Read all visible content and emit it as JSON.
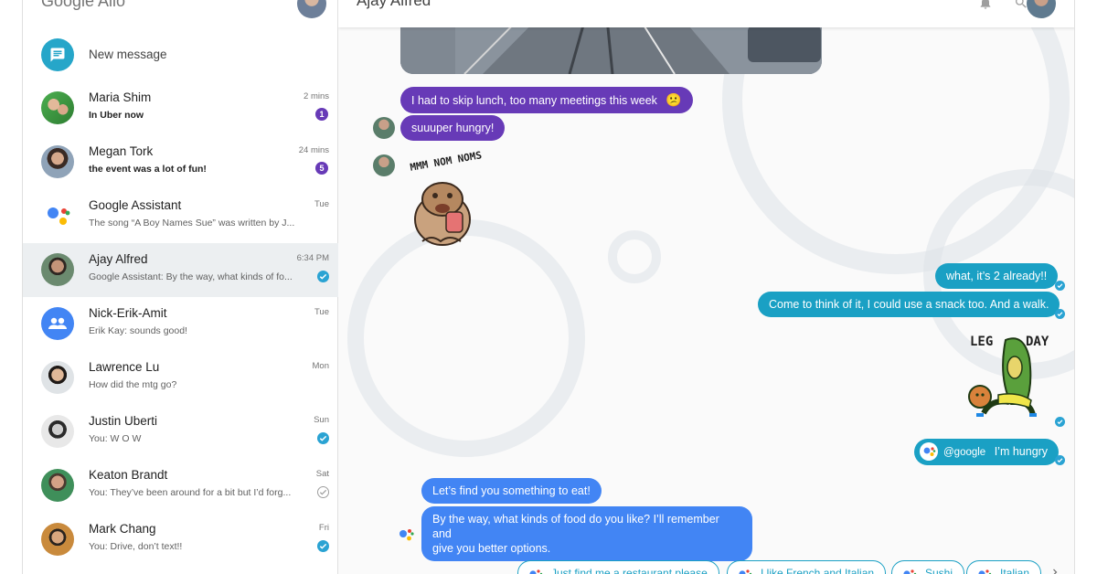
{
  "app": {
    "brand": "Google Allo"
  },
  "sidebar": {
    "new_message_label": "New message",
    "conversations": [
      {
        "name": "Maria Shim",
        "preview": "In Uber now",
        "time": "2 mins",
        "unread": "1"
      },
      {
        "name": "Megan Tork",
        "preview": "the event was a lot of fun!",
        "time": "24 mins",
        "unread": "5"
      },
      {
        "name": "Google Assistant",
        "preview": "The song “A Boy Names Sue” was written by J...",
        "time": "Tue"
      },
      {
        "name": "Ajay Alfred",
        "preview": "Google Assistant: By the way, what kinds of fo...",
        "time": "6:34 PM"
      },
      {
        "name": "Nick-Erik-Amit",
        "preview": "Erik Kay: sounds good!",
        "time": "Tue"
      },
      {
        "name": "Lawrence Lu",
        "preview": "How did the mtg go?",
        "time": "Mon"
      },
      {
        "name": "Justin Uberti",
        "preview": "You: W O W",
        "time": "Sun"
      },
      {
        "name": "Keaton Brandt",
        "preview": "You: They’ve been around for a bit but I’d forg...",
        "time": "Sat"
      },
      {
        "name": "Mark Chang",
        "preview": "You: Drive, don’t text!!",
        "time": "Fri"
      }
    ]
  },
  "chat": {
    "title": "Ajay Alfred",
    "messages": {
      "m1": "I had to skip lunch, too many meetings this week",
      "m1_emoji": "😕",
      "m2": "suuuper hungry!",
      "sticker1": "MMM NOM NOMS",
      "m3": "what, it’s 2 already!!",
      "m4": "Come to think of it, I could use a snack too. And a walk.",
      "sticker2_left": "LEG",
      "sticker2_right": "DAY",
      "m5_mention": "@google",
      "m5_text": "I’m hungry",
      "m6": "Let’s find you something to eat!",
      "m7_line1": "By the way, what kinds of food do you like? I’ll remember and",
      "m7_line2": "give you better options."
    },
    "suggestions": [
      "Just find me a restaurant please",
      "I like French and Italian",
      "Sushi",
      "Italian"
    ]
  },
  "colors": {
    "sent": "#1aa0c4",
    "received": "#673ab7",
    "assistant": "#4285f4",
    "unread_badge": "#673ab7"
  },
  "icons": [
    "chat-icon",
    "group-icon",
    "bell-icon",
    "search-icon",
    "check-icon",
    "chevron-right-icon",
    "google-assistant-icon"
  ]
}
